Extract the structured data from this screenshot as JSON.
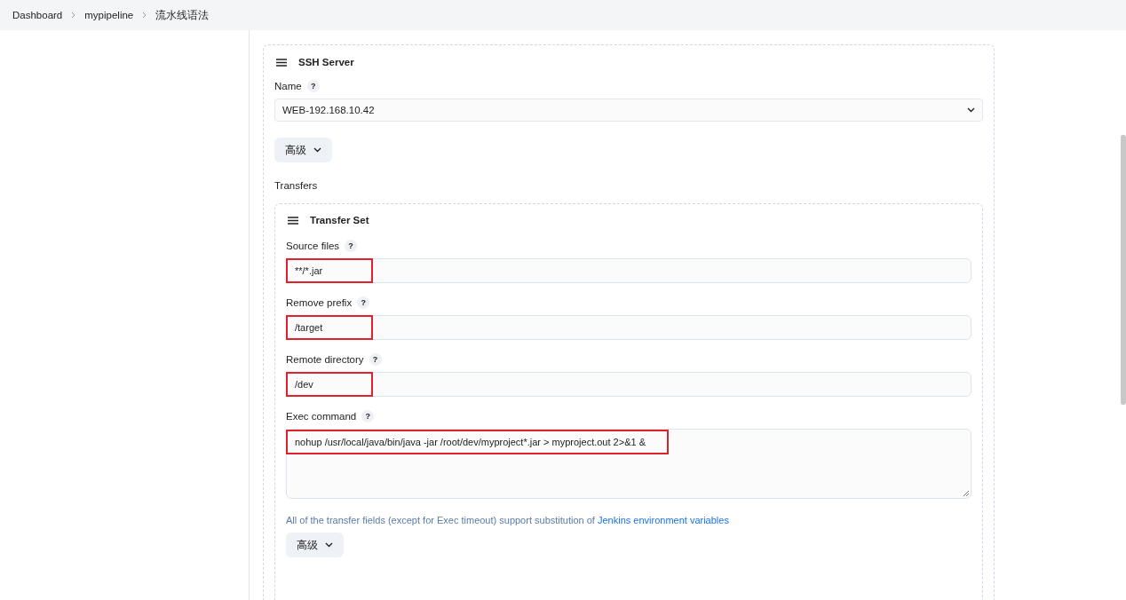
{
  "breadcrumbs": [
    {
      "label": "Dashboard"
    },
    {
      "label": "mypipeline"
    },
    {
      "label": "流水线语法"
    }
  ],
  "ssh_server": {
    "title": "SSH Server",
    "name_field": {
      "label": "Name",
      "help": "?",
      "value": "WEB-192.168.10.42"
    },
    "advanced_button": "高级",
    "transfers_label": "Transfers",
    "transfer_set": {
      "title": "Transfer Set",
      "fields": [
        {
          "kind": "input",
          "label": "Source files",
          "help": "?",
          "value": "**/*.jar",
          "highlighted": true
        },
        {
          "kind": "input",
          "label": "Remove prefix",
          "help": "?",
          "value": "/target",
          "highlighted": true
        },
        {
          "kind": "input",
          "label": "Remote directory",
          "help": "?",
          "value": "/dev",
          "highlighted": true
        },
        {
          "kind": "textarea",
          "label": "Exec command",
          "help": "?",
          "value": "nohup /usr/local/java/bin/java -jar /root/dev/myproject*.jar > myproject.out 2>&1 &",
          "highlighted": true
        }
      ],
      "note": {
        "text": "All of the transfer fields (except for Exec timeout) support substitution of",
        "link": "Jenkins environment variables"
      },
      "advanced_button": "高级"
    }
  }
}
